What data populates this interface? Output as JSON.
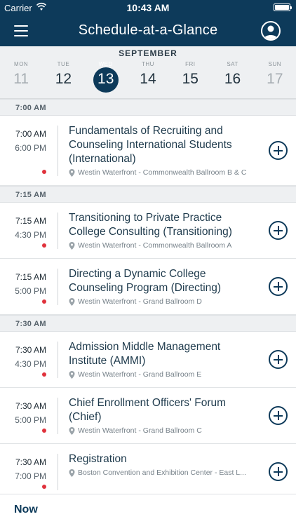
{
  "status_bar": {
    "carrier": "Carrier",
    "time": "10:43 AM",
    "battery_level": 1.0
  },
  "header": {
    "title": "Schedule-at-a-Glance",
    "menu_icon": "hamburger-menu-icon",
    "profile_icon": "user-profile-icon"
  },
  "calendar": {
    "month": "SEPTEMBER",
    "days": [
      {
        "name": "MON",
        "num": "11"
      },
      {
        "name": "TUE",
        "num": "12"
      },
      {
        "name": "WED",
        "num": "13"
      },
      {
        "name": "THU",
        "num": "14"
      },
      {
        "name": "FRI",
        "num": "15"
      },
      {
        "name": "SAT",
        "num": "16"
      },
      {
        "name": "SUN",
        "num": "17"
      }
    ],
    "selected_day": "13"
  },
  "schedule": {
    "sections": [
      {
        "time": "7:00 AM",
        "sessions": [
          {
            "start": "7:00 AM",
            "end": "6:00 PM",
            "title": "Fundamentals of Recruiting and Counseling International Students (International)",
            "location": "Westin Waterfront - Commonwealth Ballroom B & C"
          }
        ]
      },
      {
        "time": "7:15 AM",
        "sessions": [
          {
            "start": "7:15 AM",
            "end": "4:30 PM",
            "title": "Transitioning to Private Practice College Consulting (Transitioning)",
            "location": "Westin Waterfront - Commonwealth Ballroom A"
          },
          {
            "start": "7:15 AM",
            "end": "5:00 PM",
            "title": "Directing a Dynamic College Counseling Program (Directing)",
            "location": "Westin Waterfront - Grand Ballroom D"
          }
        ]
      },
      {
        "time": "7:30 AM",
        "sessions": [
          {
            "start": "7:30 AM",
            "end": "4:30 PM",
            "title": "Admission Middle Management Institute (AMMI)",
            "location": "Westin Waterfront - Grand Ballroom E"
          },
          {
            "start": "7:30 AM",
            "end": "5:00 PM",
            "title": "Chief Enrollment Officers' Forum (Chief)",
            "location": "Westin Waterfront - Grand Ballroom C"
          },
          {
            "start": "7:30 AM",
            "end": "7:00 PM",
            "title": "Registration",
            "location": "Boston Convention and Exhibition Center - East L..."
          }
        ]
      }
    ]
  },
  "bottom_bar": {
    "now_label": "Now"
  },
  "colors": {
    "brand": "#0d3a5a",
    "dot": "#e0323c",
    "section_bg": "#eef0f2"
  }
}
